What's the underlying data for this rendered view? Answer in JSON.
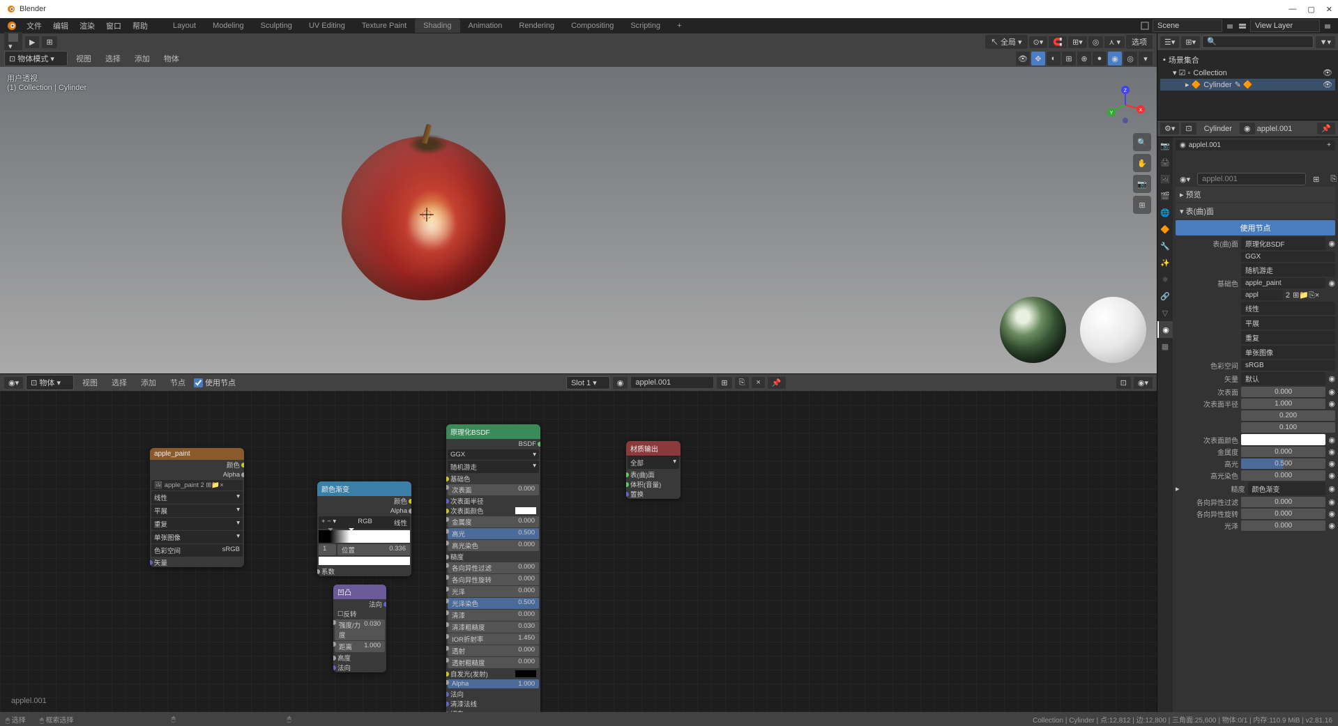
{
  "app": {
    "title": "Blender"
  },
  "menu": {
    "file": "文件",
    "edit": "编辑",
    "render": "渲染",
    "window": "窗口",
    "help": "帮助"
  },
  "workspaces": {
    "layout": "Layout",
    "modeling": "Modeling",
    "sculpting": "Sculpting",
    "uv": "UV Editing",
    "texture": "Texture Paint",
    "shading": "Shading",
    "animation": "Animation",
    "rendering": "Rendering",
    "compositing": "Compositing",
    "scripting": "Scripting"
  },
  "scene": {
    "label": "Scene",
    "viewlayer": "View Layer"
  },
  "header2": {
    "global": "全局",
    "options": "选项"
  },
  "viewport": {
    "mode": "物体模式",
    "view": "视图",
    "select": "选择",
    "add": "添加",
    "object": "物体",
    "label1": "用户透视",
    "label2": "(1) Collection | Cylinder"
  },
  "node_editor": {
    "mode": "物体",
    "view": "视图",
    "select": "选择",
    "add": "添加",
    "node": "节点",
    "use_nodes": "使用节点",
    "slot": "Slot 1",
    "material": "applel.001",
    "bottom_label": "applel.001"
  },
  "nodes": {
    "image_tex": {
      "title": "apple_paint",
      "out_color": "颜色",
      "out_alpha": "Alpha",
      "image": "apple_paint",
      "interp": "线性",
      "proj": "平展",
      "repeat": "重复",
      "source": "单张图像",
      "colorspace_l": "色彩空间",
      "colorspace_v": "sRGB",
      "vector": "矢量"
    },
    "color_ramp": {
      "title": "颜色渐变",
      "out_color": "颜色",
      "out_alpha": "Alpha",
      "mode": "RGB",
      "interp": "线性",
      "idx": "1",
      "pos_l": "位置",
      "pos_v": "0.336",
      "fac": "系数"
    },
    "bump": {
      "title": "凹凸",
      "out_normal": "法向",
      "invert": "反转",
      "strength_l": "强度/力度",
      "strength_v": "0.030",
      "distance_l": "距离",
      "distance_v": "1.000",
      "height": "高度",
      "normal": "法向"
    },
    "bsdf": {
      "title": "原理化BSDF",
      "out": "BSDF",
      "dist": "GGX",
      "sss": "随机游走",
      "base": "基础色",
      "subsurf": "次表面",
      "subsurf_r": "次表面半径",
      "subsurf_c": "次表面颜色",
      "metallic": "金属度",
      "specular": "高光",
      "spec_tint": "高光染色",
      "rough": "糙度",
      "aniso": "各向异性过滤",
      "aniso_r": "各向异性旋转",
      "sheen": "光泽",
      "sheen_t": "光泽染色",
      "clearcoat": "清漆",
      "clearcoat_r": "清漆粗糙度",
      "ior": "IOR折射率",
      "transmission": "透射",
      "trans_r": "透射粗糙度",
      "emission": "自发光(发射)",
      "alpha": "Alpha",
      "normal": "法向",
      "cc_normal": "清漆法线",
      "tangent": "切向",
      "v000": "0.000",
      "v050": "0.500",
      "v003": "0.030",
      "v145": "1.450",
      "v100": "1.000"
    },
    "output": {
      "title": "材质输出",
      "target": "全部",
      "surface": "表(曲)面",
      "volume": "体积(音量)",
      "displace": "置换"
    }
  },
  "outliner": {
    "scene_collection": "场景集合",
    "collection": "Collection",
    "cylinder": "Cylinder"
  },
  "props": {
    "object": "Cylinder",
    "material": "applel.001",
    "preview": "预览",
    "surface_section": "表(曲)面",
    "use_nodes": "使用节点",
    "surface_l": "表(曲)面",
    "surface_v": "原理化BSDF",
    "ggx": "GGX",
    "random_walk": "随机游走",
    "base_l": "基础色",
    "base_v": "apple_paint",
    "appl": "appl",
    "two": "2",
    "linear": "线性",
    "flat": "平展",
    "repeat": "重复",
    "single": "单张图像",
    "cs_l": "色彩空间",
    "cs_v": "sRGB",
    "vector_l": "矢量",
    "vector_v": "默认",
    "subsurf_l": "次表面",
    "v0000": "0.000",
    "subsurf_r_l": "次表面半径",
    "v1000": "1.000",
    "v0200": "0.200",
    "v0100": "0.100",
    "subsurf_c_l": "次表面颜色",
    "metallic_l": "金属度",
    "specular_l": "高光",
    "v0500": "0.500",
    "spectint_l": "高光染色",
    "rough_l": "糙度",
    "rough_v": "颜色渐变",
    "aniso_l": "各向异性过滤",
    "aniso_r_l": "各向异性旋转",
    "sheen_l": "光泽"
  },
  "status": {
    "select": "选择",
    "box": "框索选择",
    "right": "Collection | Cylinder | 点:12,812 | 边:12,800 | 三角面:25,600 | 物体:0/1 | 内存:110.9 MiB | v2.81.16"
  }
}
